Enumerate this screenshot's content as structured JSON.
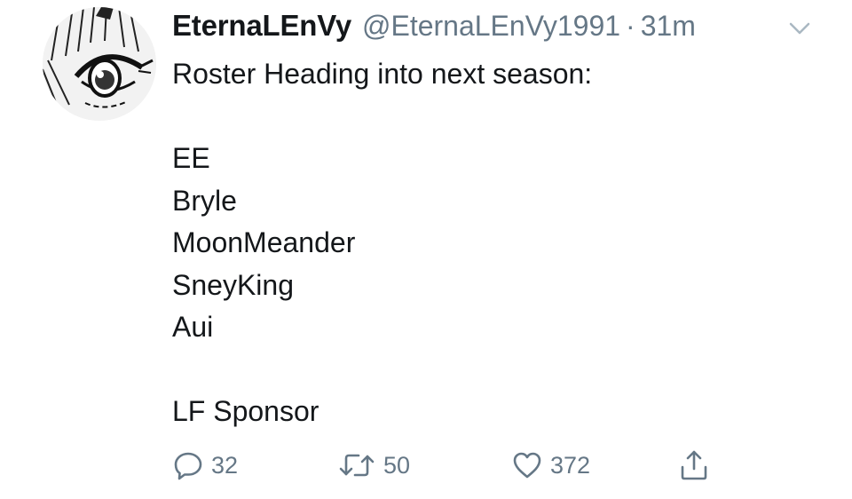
{
  "tweet": {
    "author": {
      "display_name": "EternaLEnVy",
      "handle": "@EternaLEnVy1991",
      "separator": "·",
      "timestamp": "31m"
    },
    "text_lines": [
      "Roster Heading into next season:",
      "",
      "EE",
      "Bryle",
      "MoonMeander",
      "SneyKing",
      "Aui",
      "",
      "LF Sponsor"
    ],
    "actions": {
      "replies": "32",
      "retweets": "50",
      "likes": "372"
    },
    "icons": {
      "reply": "reply-icon",
      "retweet": "retweet-icon",
      "like": "heart-icon",
      "share": "share-icon",
      "menu": "chevron-down-icon"
    },
    "colors": {
      "text": "#14171a",
      "secondary": "#657786"
    }
  }
}
